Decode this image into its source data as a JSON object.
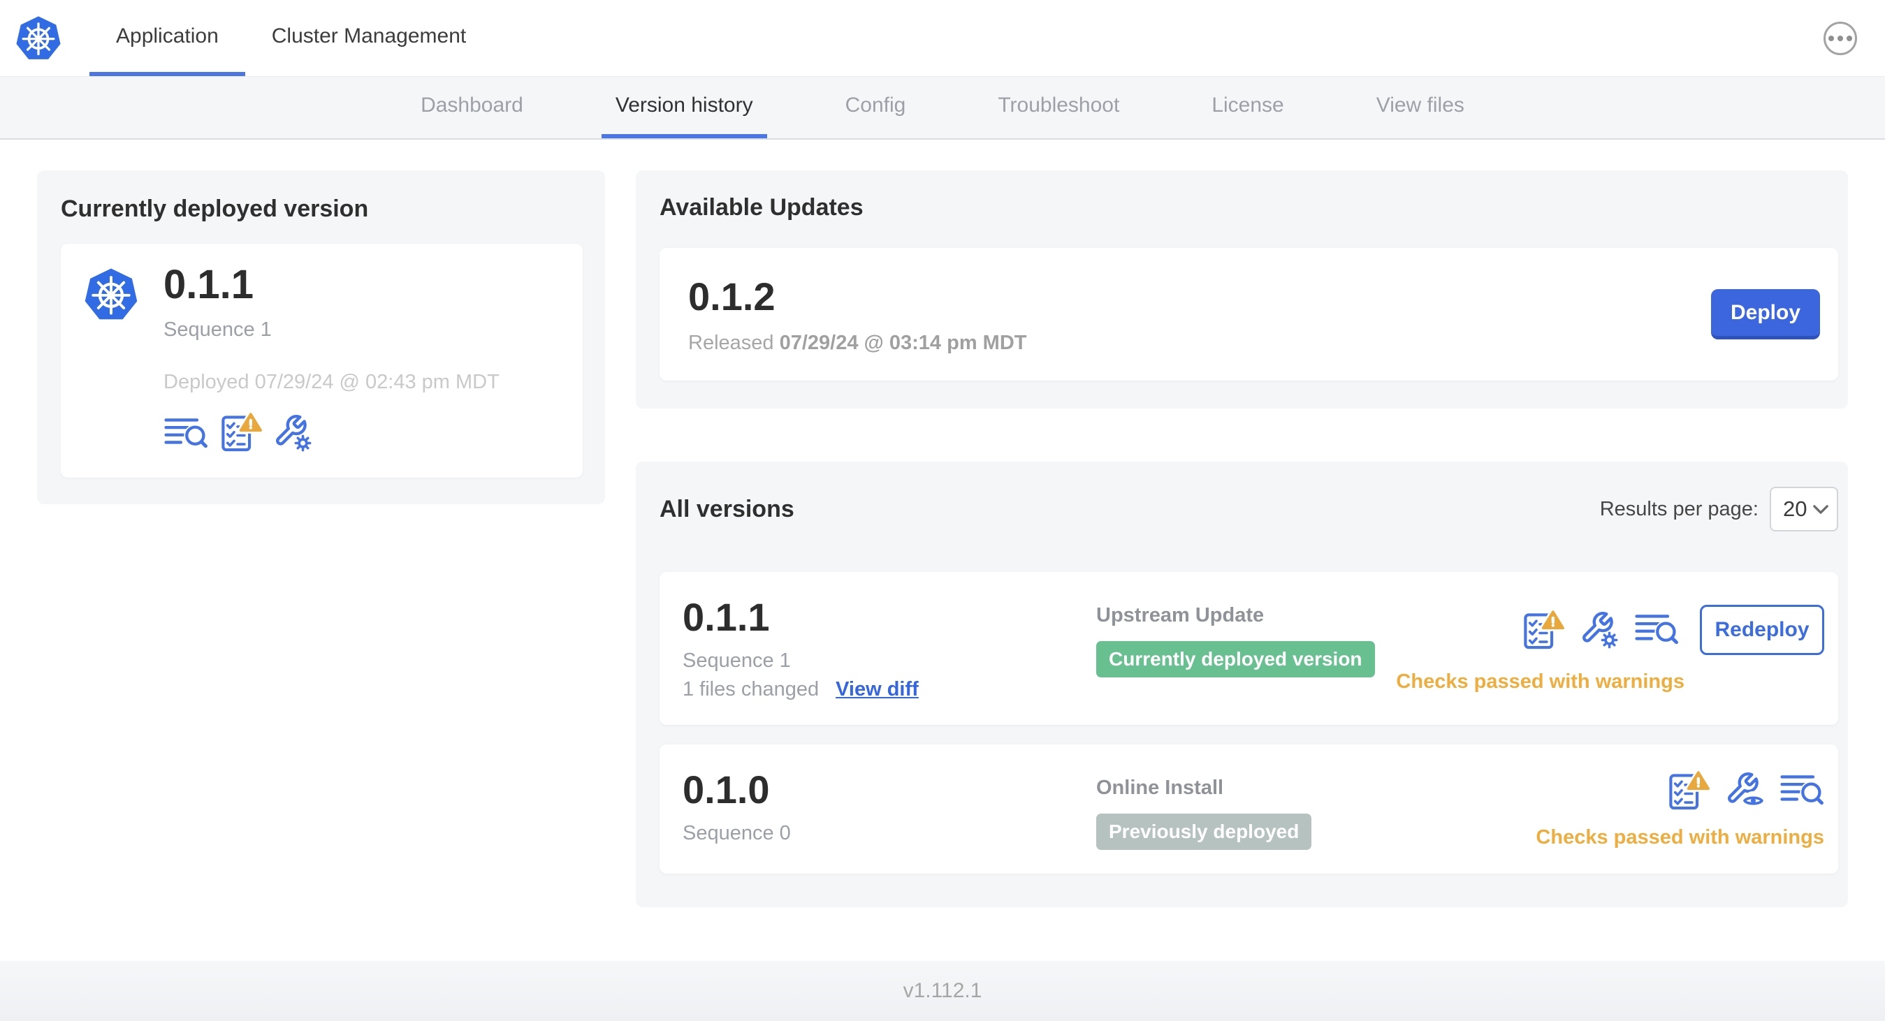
{
  "header": {
    "product_tabs": [
      {
        "label": "Application",
        "active": true
      },
      {
        "label": "Cluster Management",
        "active": false
      }
    ],
    "more_icon": "ellipsis-in-circle",
    "logo_icon": "kubernetes-helm"
  },
  "subnav": {
    "items": [
      {
        "label": "Dashboard",
        "active": false
      },
      {
        "label": "Version history",
        "active": true
      },
      {
        "label": "Config",
        "active": false
      },
      {
        "label": "Troubleshoot",
        "active": false
      },
      {
        "label": "License",
        "active": false
      },
      {
        "label": "View files",
        "active": false
      }
    ]
  },
  "current_version_card": {
    "title": "Currently deployed version",
    "version": "0.1.1",
    "sequence": "Sequence 1",
    "deployed_text": "Deployed 07/29/24 @ 02:43 pm MDT",
    "icons": [
      "release-notes-lines-magnifier",
      "preflight-checklist-warning",
      "config-wrench-gear"
    ]
  },
  "available_updates": {
    "title": "Available Updates",
    "version": "0.1.2",
    "released_label": "Released",
    "released_date": "07/29/24 @ 03:14 pm MDT",
    "deploy_label": "Deploy"
  },
  "all_versions": {
    "title": "All versions",
    "results_per_page_label": "Results per page:",
    "results_per_page_value": "20",
    "rows": [
      {
        "version": "0.1.1",
        "sequence": "Sequence 1",
        "files_changed": "1 files changed",
        "view_diff_label": "View diff",
        "source": "Upstream Update",
        "badge": "Currently deployed version",
        "badge_color": "#68bf90",
        "status": "Checks passed with warnings",
        "action_label": "Redeploy",
        "icons": [
          "preflight-checklist-warning",
          "config-wrench-gear",
          "release-notes-lines-magnifier"
        ]
      },
      {
        "version": "0.1.0",
        "sequence": "Sequence 0",
        "source": "Online Install",
        "badge": "Previously deployed",
        "badge_color": "#b5c2bf",
        "status": "Checks passed with warnings",
        "icons": [
          "preflight-checklist-warning",
          "config-wrench-eye",
          "release-notes-lines-magnifier"
        ]
      }
    ]
  },
  "footer": {
    "app_version": "v1.112.1"
  },
  "colors": {
    "accent_blue": "#3b6ce0",
    "k8s_blue": "#326ce5",
    "active_underline": "#4a77e5",
    "success_green": "#68bf90",
    "muted_badge_gray": "#b5c2bf",
    "warning_amber": "#eead3f",
    "card_background": "#f5f6f8"
  }
}
